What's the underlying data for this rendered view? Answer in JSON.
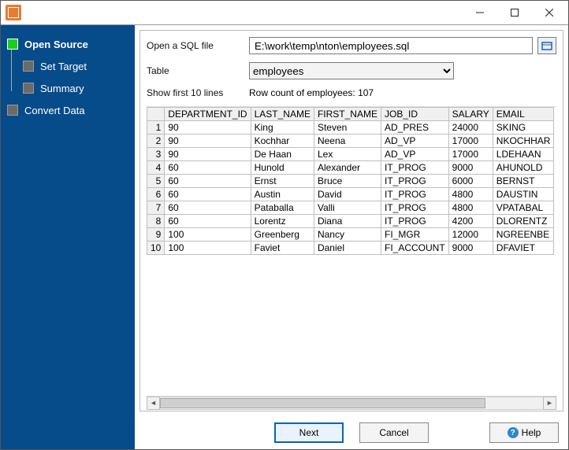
{
  "sidebar": {
    "items": [
      {
        "label": "Open Source",
        "active": true,
        "sub": false
      },
      {
        "label": "Set Target",
        "active": false,
        "sub": true
      },
      {
        "label": "Summary",
        "active": false,
        "sub": true
      },
      {
        "label": "Convert Data",
        "active": false,
        "sub": false
      }
    ]
  },
  "form": {
    "open_label": "Open a SQL file",
    "path_value": "E:\\work\\temp\\nton\\employees.sql",
    "table_label": "Table",
    "table_value": "employees",
    "show_label": "Show first 10 lines",
    "count_label": "Row count of employees: 107"
  },
  "table": {
    "headers": [
      "DEPARTMENT_ID",
      "LAST_NAME",
      "FIRST_NAME",
      "JOB_ID",
      "SALARY",
      "EMAIL"
    ],
    "rows": [
      [
        "90",
        "King",
        "Steven",
        "AD_PRES",
        "24000",
        "SKING"
      ],
      [
        "90",
        "Kochhar",
        "Neena",
        "AD_VP",
        "17000",
        "NKOCHHAR"
      ],
      [
        "90",
        "De Haan",
        "Lex",
        "AD_VP",
        "17000",
        "LDEHAAN"
      ],
      [
        "60",
        "Hunold",
        "Alexander",
        "IT_PROG",
        "9000",
        "AHUNOLD"
      ],
      [
        "60",
        "Ernst",
        "Bruce",
        "IT_PROG",
        "6000",
        "BERNST"
      ],
      [
        "60",
        "Austin",
        "David",
        "IT_PROG",
        "4800",
        "DAUSTIN"
      ],
      [
        "60",
        "Pataballa",
        "Valli",
        "IT_PROG",
        "4800",
        "VPATABAL"
      ],
      [
        "60",
        "Lorentz",
        "Diana",
        "IT_PROG",
        "4200",
        "DLORENTZ"
      ],
      [
        "100",
        "Greenberg",
        "Nancy",
        "FI_MGR",
        "12000",
        "NGREENBE"
      ],
      [
        "100",
        "Faviet",
        "Daniel",
        "FI_ACCOUNT",
        "9000",
        "DFAVIET"
      ]
    ]
  },
  "footer": {
    "next": "Next",
    "cancel": "Cancel",
    "help": "Help"
  },
  "icons": {
    "browse": "browse-icon",
    "help": "?"
  }
}
